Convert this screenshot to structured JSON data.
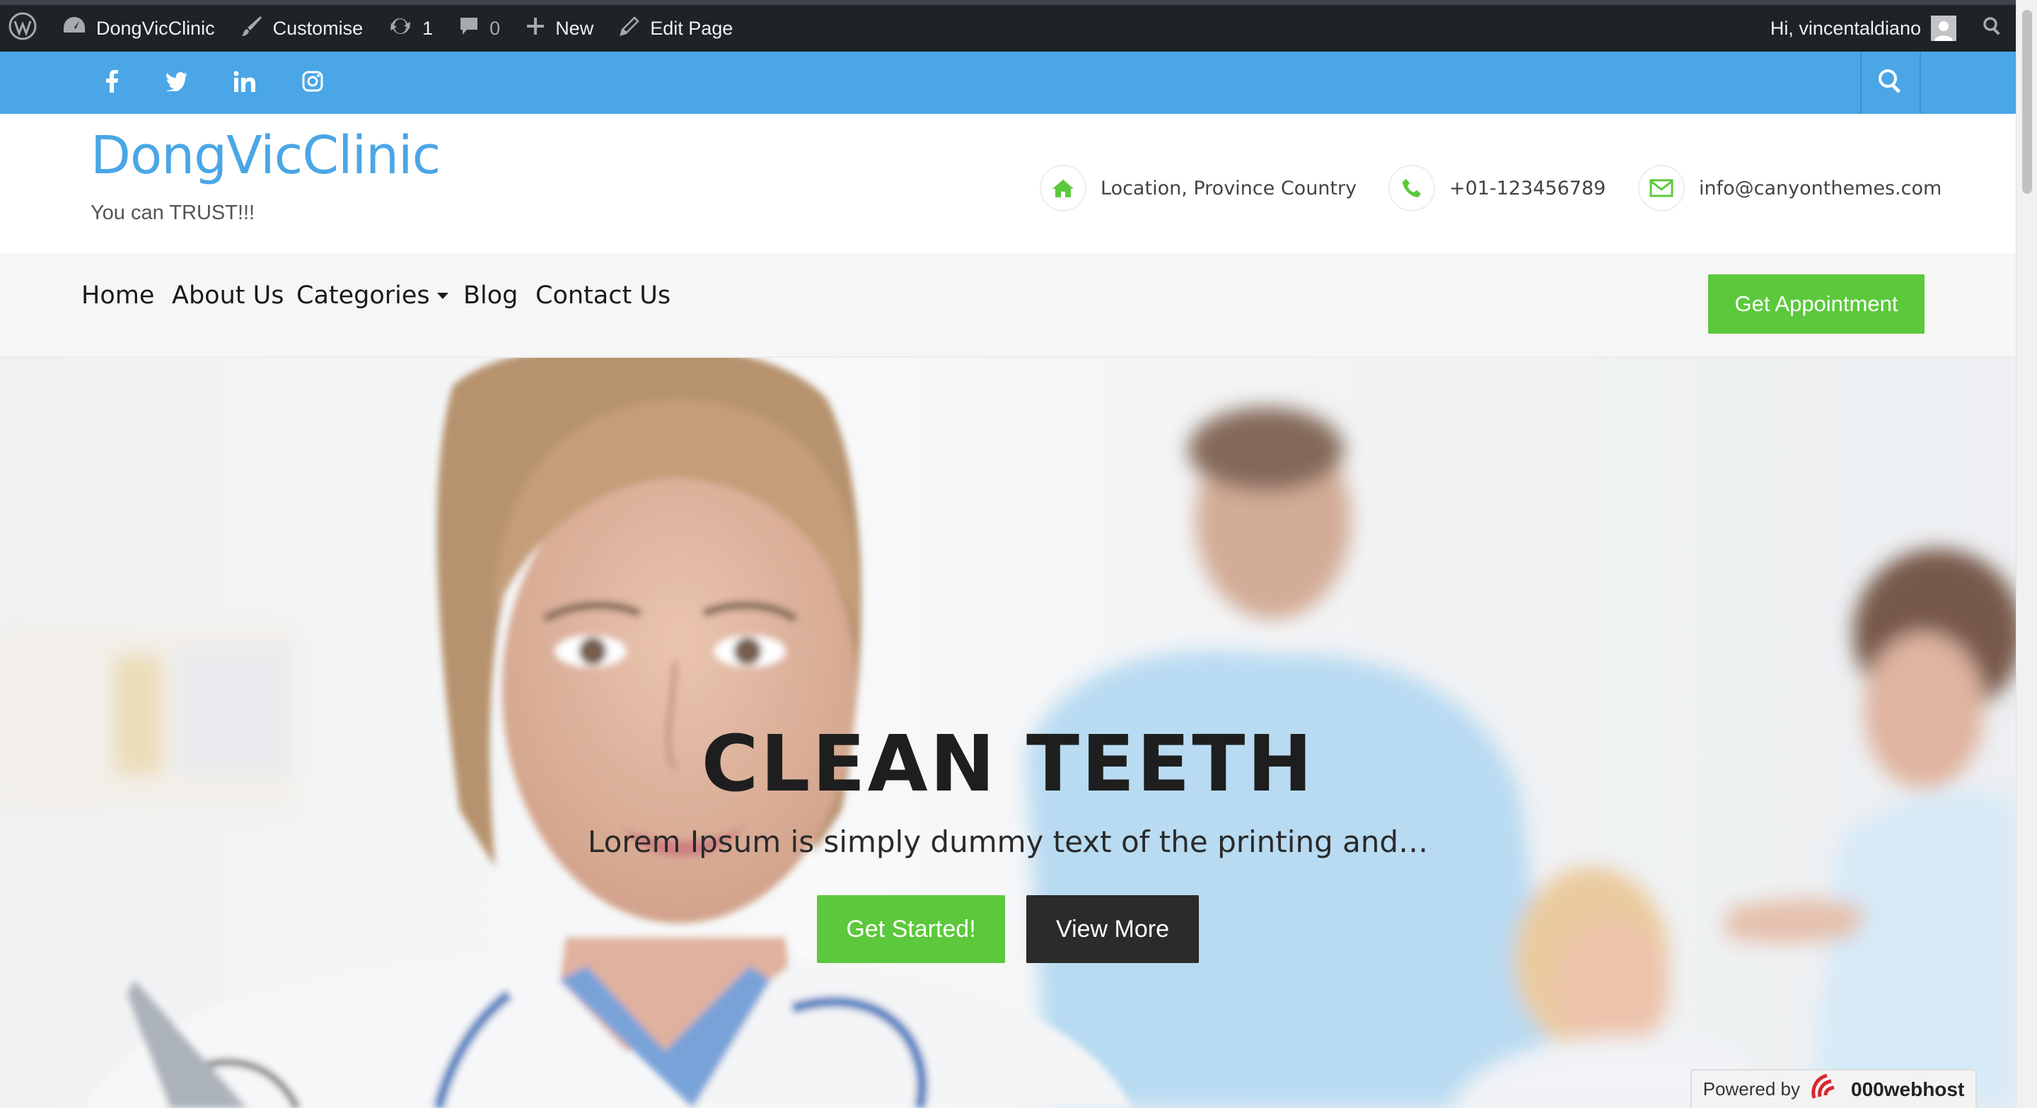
{
  "admin_bar": {
    "wp_logo_icon": "wordpress-icon",
    "site_name": "DongVicClinic",
    "customise": "Customise",
    "updates_count": "1",
    "comments_count": "0",
    "new": "New",
    "edit_page": "Edit Page",
    "greeting": "Hi, vincentaldiano"
  },
  "social": [
    "facebook-icon",
    "twitter-icon",
    "linkedin-icon",
    "instagram-icon"
  ],
  "header": {
    "site_title": "DongVicClinic",
    "tagline": "You can TRUST!!!",
    "contacts": {
      "location": "Location, Province Country",
      "phone": "+01-123456789",
      "email": "info@canyonthemes.com"
    }
  },
  "nav": {
    "items": [
      "Home",
      "About Us",
      "Categories",
      "Blog",
      "Contact Us"
    ],
    "cta": "Get Appointment"
  },
  "hero": {
    "title": "CLEAN TEETH",
    "text": "Lorem Ipsum is simply dummy text of the printing and…",
    "primary_button": "Get Started!",
    "secondary_button": "View More"
  },
  "powered_by": {
    "label": "Powered by",
    "brand": "000webhost"
  },
  "colors": {
    "admin_bar": "#1d2327",
    "brand_blue": "#4aa6e6",
    "accent_green": "#5cc83c",
    "dark_button": "#2b2b2b"
  }
}
